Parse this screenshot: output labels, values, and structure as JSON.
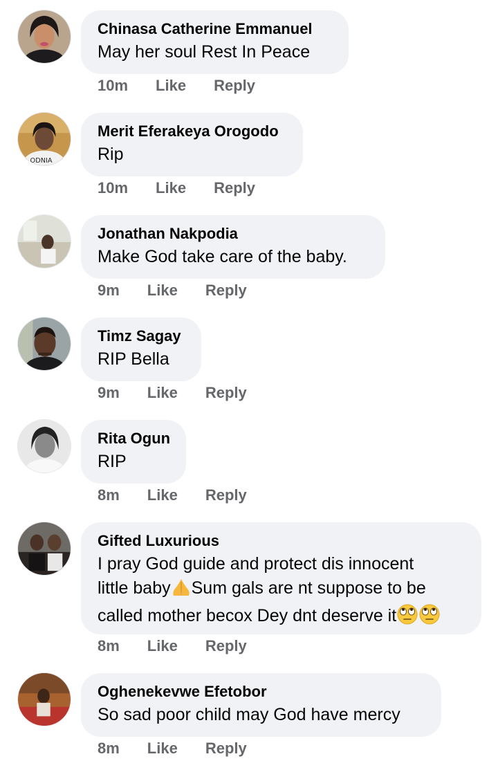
{
  "comments": [
    {
      "author": "Chinasa Catherine Emmanuel",
      "lines": [
        "May her soul Rest In Peace"
      ],
      "time": "10m",
      "like": "Like",
      "reply": "Reply"
    },
    {
      "author": "Merit Eferakeya Orogodo",
      "lines": [
        "Rip"
      ],
      "time": "10m",
      "like": "Like",
      "reply": "Reply"
    },
    {
      "author": "Jonathan Nakpodia",
      "lines": [
        "Make God take care of the baby."
      ],
      "time": "9m",
      "like": "Like",
      "reply": "Reply"
    },
    {
      "author": "Timz Sagay",
      "lines": [
        "RIP Bella"
      ],
      "time": "9m",
      "like": "Like",
      "reply": "Reply"
    },
    {
      "author": "Rita Ogun",
      "lines": [
        "RIP"
      ],
      "time": "8m",
      "like": "Like",
      "reply": "Reply"
    },
    {
      "author": "Gifted Luxurious",
      "lines": [
        "I pray God guide and protect dis innocent",
        "little baby",
        "Sum gals are nt suppose to be",
        "called mother becox Dey dnt deserve it"
      ],
      "emojis": [
        "folded-hands-emoji",
        "face-with-rolling-eyes-emoji"
      ],
      "time": "8m",
      "like": "Like",
      "reply": "Reply"
    },
    {
      "author": "Oghenekevwe Efetobor",
      "lines": [
        "So sad poor child may God have mercy"
      ],
      "time": "8m",
      "like": "Like",
      "reply": "Reply"
    }
  ],
  "colors": {
    "bubble": "#f0f2f5",
    "meta": "#65676b",
    "text": "#050505"
  }
}
